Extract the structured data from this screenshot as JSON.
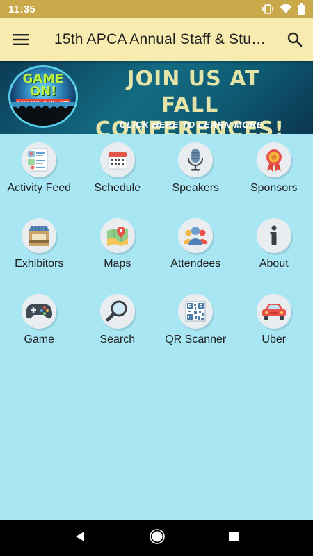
{
  "status_bar": {
    "time": "11:35"
  },
  "app_bar": {
    "title": "15th APCA Annual Staff & Stu…"
  },
  "banner": {
    "badge_title": "GAME ON!",
    "badge_subtitle": "ENGAGE & RETAIN",
    "line1": "JOIN US AT",
    "line2": "FALL CONFERENCES!",
    "line3": "CLICK HERE TO LEARN MORE"
  },
  "tiles": [
    {
      "label": "Activity Feed",
      "icon": "activity-feed-icon"
    },
    {
      "label": "Schedule",
      "icon": "calendar-icon"
    },
    {
      "label": "Speakers",
      "icon": "microphone-icon"
    },
    {
      "label": "Sponsors",
      "icon": "ribbon-badge-icon"
    },
    {
      "label": "Exhibitors",
      "icon": "booth-icon"
    },
    {
      "label": "Maps",
      "icon": "map-icon"
    },
    {
      "label": "Attendees",
      "icon": "people-icon"
    },
    {
      "label": "About",
      "icon": "info-icon"
    },
    {
      "label": "Game",
      "icon": "gamepad-icon"
    },
    {
      "label": "Search",
      "icon": "magnifier-icon"
    },
    {
      "label": "QR Scanner",
      "icon": "qr-code-icon"
    },
    {
      "label": "Uber",
      "icon": "car-icon"
    }
  ],
  "colors": {
    "status_bar": "#c9a94a",
    "app_bar": "#f7ebb0",
    "background": "#a8e6f4",
    "icon_circle": "#e9edf0"
  }
}
